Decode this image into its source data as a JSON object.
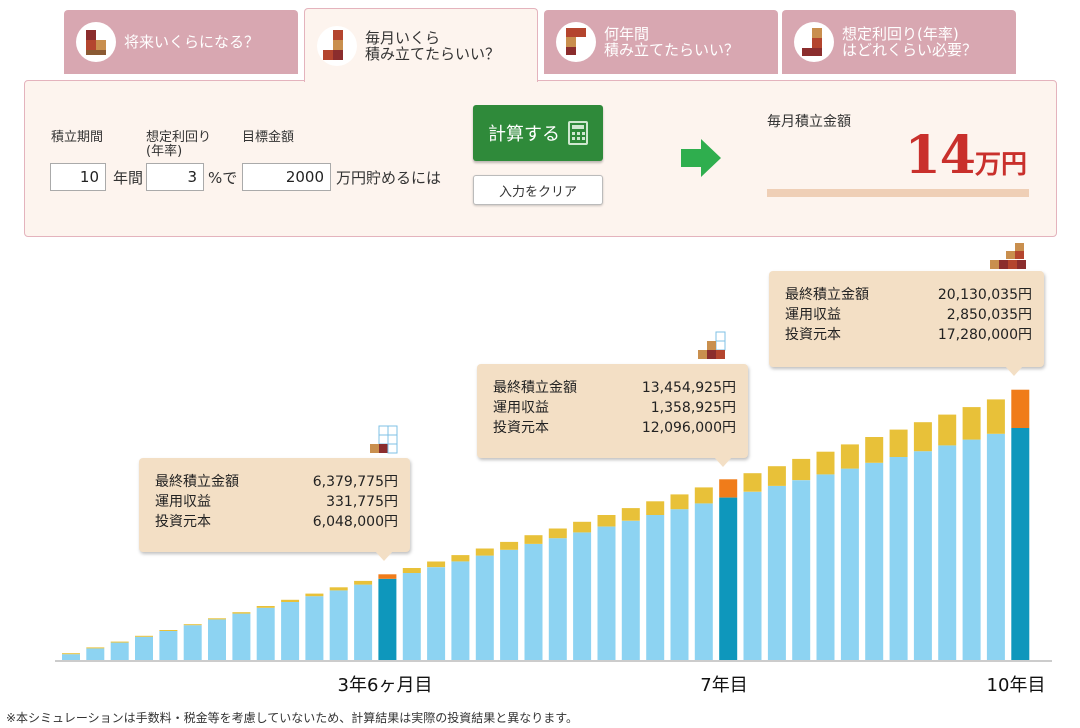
{
  "tabs": [
    {
      "label": "将来いくらになる？",
      "active": false
    },
    {
      "label": "毎月いくら\n積み立てたらいい？",
      "active": true
    },
    {
      "label": "何年間\n積み立てたらいい？",
      "active": false
    },
    {
      "label": "想定利回り(年率)\nはどれくらい必要？",
      "active": false
    }
  ],
  "form": {
    "period_label": "積立期間",
    "rate_label": "想定利回り\n(年率)",
    "target_label": "目標金額",
    "period_value": "10",
    "period_unit": "年間",
    "rate_value": "3",
    "rate_unit": "%で",
    "target_value": "2000",
    "target_unit": "万円貯めるには",
    "calc_button": "計算する",
    "clear_button": "入力をクリア"
  },
  "result": {
    "label": "毎月積立金額",
    "value": "14",
    "unit": "万円"
  },
  "callouts": [
    {
      "rows": [
        {
          "k": "最終積立金額",
          "v": "6,379,775円"
        },
        {
          "k": "運用収益",
          "v": "331,775円"
        },
        {
          "k": "投資元本",
          "v": "6,048,000円"
        }
      ]
    },
    {
      "rows": [
        {
          "k": "最終積立金額",
          "v": "13,454,925円"
        },
        {
          "k": "運用収益",
          "v": "1,358,925円"
        },
        {
          "k": "投資元本",
          "v": "12,096,000円"
        }
      ]
    },
    {
      "rows": [
        {
          "k": "最終積立金額",
          "v": "20,130,035円"
        },
        {
          "k": "運用収益",
          "v": "2,850,035円"
        },
        {
          "k": "投資元本",
          "v": "17,280,000円"
        }
      ]
    }
  ],
  "chart_data": {
    "type": "bar",
    "stacked": true,
    "x_tick_labels": [
      "3年6ヶ月目",
      "7年目",
      "10年目"
    ],
    "highlight_indices": [
      13,
      27,
      39
    ],
    "series": [
      {
        "name": "投資元本",
        "color": "#8dd3f2",
        "highlight_color": "#0e97bc",
        "values": [
          432000,
          864000,
          1296000,
          1728000,
          2160000,
          2592000,
          3024000,
          3456000,
          3888000,
          4320000,
          4752000,
          5184000,
          5616000,
          6048000,
          6480000,
          6912000,
          7344000,
          7776000,
          8208000,
          8640000,
          9072000,
          9504000,
          9936000,
          10368000,
          10800000,
          11232000,
          11664000,
          12096000,
          12528000,
          12960000,
          13392000,
          13824000,
          14256000,
          14688000,
          15120000,
          15552000,
          15984000,
          16416000,
          16848000,
          17280000
        ]
      },
      {
        "name": "運用収益",
        "color": "#e8c139",
        "highlight_color": "#f07c1a",
        "values": [
          1620,
          6480,
          14580,
          25920,
          40500,
          58320,
          79380,
          103680,
          131220,
          162000,
          196020,
          233280,
          273780,
          331775,
          370000,
          420000,
          470000,
          530000,
          590000,
          650000,
          720000,
          790000,
          860000,
          940000,
          1020000,
          1100000,
          1190000,
          1358925,
          1380000,
          1470000,
          1580000,
          1690000,
          1800000,
          1920000,
          2040000,
          2160000,
          2290000,
          2420000,
          2560000,
          2850035
        ]
      }
    ],
    "ylim": [
      0,
      21000000
    ],
    "xlabel": "",
    "ylabel": ""
  },
  "footnote": "※本シミュレーションは手数料・税金等を考慮していないため、計算結果は実際の投資結果と異なります。"
}
